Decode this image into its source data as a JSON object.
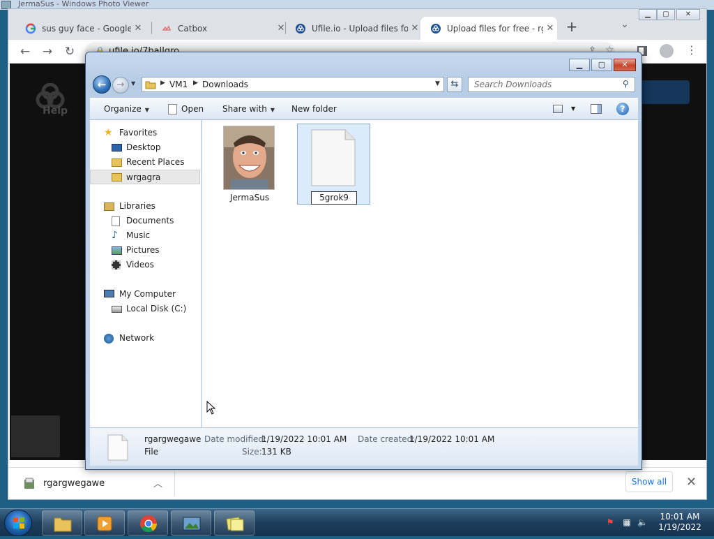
{
  "photo_viewer": {
    "title": "JermaSus - Windows Photo Viewer"
  },
  "browser": {
    "tabs": [
      {
        "label": "sus guy face - Google Se",
        "icon": "google-icon"
      },
      {
        "label": "Catbox",
        "icon": "catbox-icon"
      },
      {
        "label": "Ufile.io - Upload files for",
        "icon": "ufile-icon"
      },
      {
        "label": "Upload files for free - rg",
        "icon": "ufile-icon",
        "active": true
      }
    ],
    "url": "ufile.io/7ballqro",
    "page": {
      "help_label": "Help"
    },
    "download_bar": {
      "file_name": "rgargwegawe",
      "show_all": "Show all"
    }
  },
  "explorer": {
    "breadcrumb": [
      "VM1",
      "Downloads"
    ],
    "search_placeholder": "Search Downloads",
    "commands": {
      "organize": "Organize",
      "open": "Open",
      "share_with": "Share with",
      "new_folder": "New folder"
    },
    "nav": {
      "favorites": "Favorites",
      "desktop": "Desktop",
      "recent_places": "Recent Places",
      "wrgagra": "wrgagra",
      "libraries": "Libraries",
      "documents": "Documents",
      "music": "Music",
      "pictures": "Pictures",
      "videos": "Videos",
      "my_computer": "My Computer",
      "local_disk": "Local Disk (C:)",
      "network": "Network"
    },
    "files": [
      {
        "name": "JermaSus",
        "type": "image"
      },
      {
        "name": "5grok9",
        "type": "file",
        "renaming": true
      }
    ],
    "details": {
      "name": "rgargwegawe",
      "type": "File",
      "date_modified_label": "Date modified:",
      "date_modified": "1/19/2022 10:01 AM",
      "date_created_label": "Date created:",
      "date_created": "1/19/2022 10:01 AM",
      "size_label": "Size:",
      "size": "131 KB"
    }
  },
  "taskbar": {
    "time": "10:01 AM",
    "date": "1/19/2022"
  },
  "colors": {
    "chrome_tabstrip": "#dee1e6",
    "explorer_frame": "#c2d6ec",
    "selection": "#dcebfc",
    "taskbar": "#1d3d5c"
  }
}
